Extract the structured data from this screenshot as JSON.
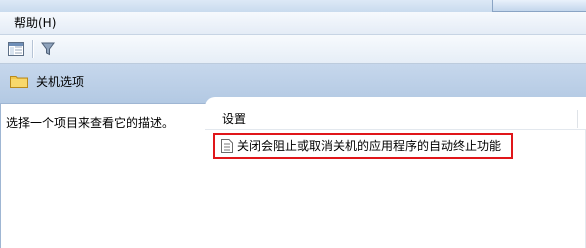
{
  "menu": {
    "help": "帮助(H)"
  },
  "toolbar": {
    "icons": [
      "show-hide-console-tree-icon",
      "filter-icon"
    ]
  },
  "section": {
    "title": "关机选项",
    "icon": "folder-icon"
  },
  "description": {
    "text": "选择一个项目来查看它的描述。"
  },
  "list": {
    "column_header": "设置",
    "items": [
      {
        "label": "关闭会阻止或取消关机的应用程序的自动终止功能",
        "icon": "policy-setting-icon",
        "highlighted": true
      }
    ]
  },
  "colors": {
    "highlight_border": "#e0161a",
    "header_band": "#b9cde6"
  }
}
